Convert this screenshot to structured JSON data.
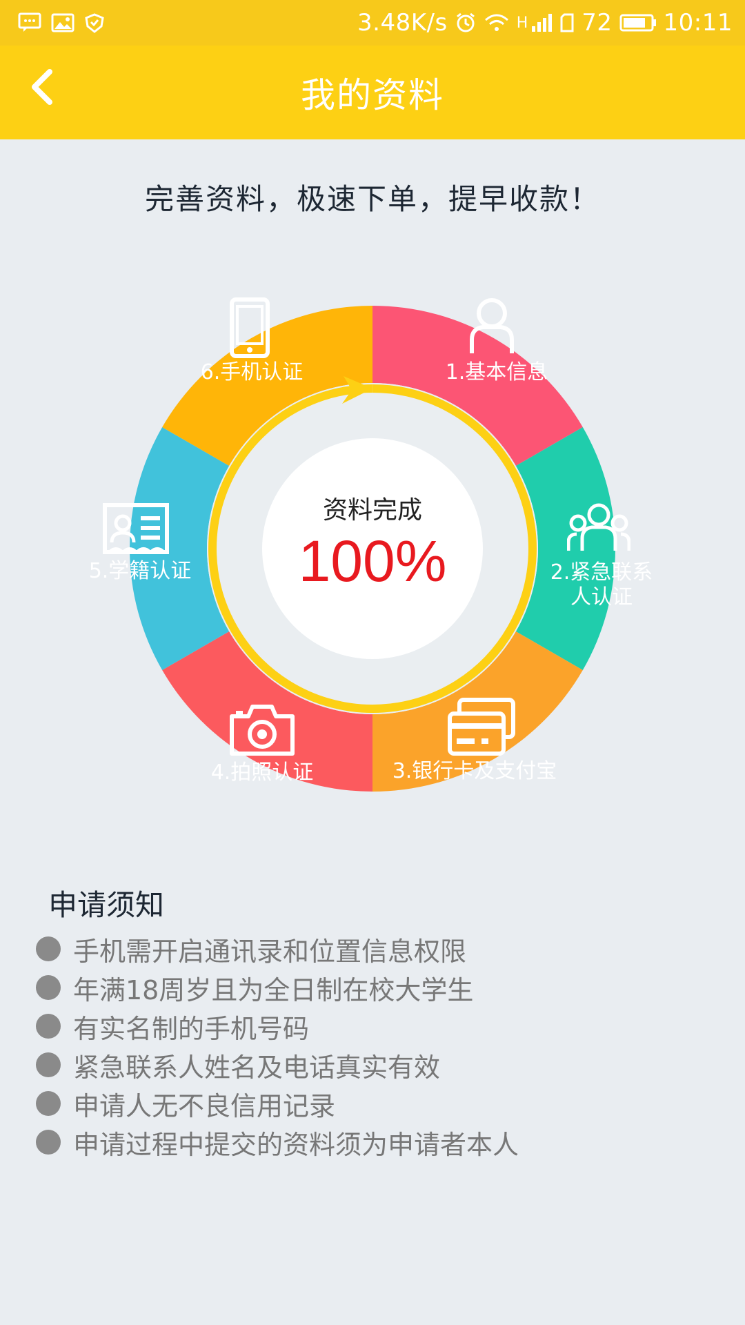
{
  "status_bar": {
    "net_speed": "3.48K/s",
    "network_type": "H",
    "battery": "72",
    "time": "10:11",
    "icons": [
      "message-icon",
      "image-icon",
      "shield-icon",
      "alarm-icon",
      "wifi-icon",
      "signal-icon",
      "sim-icon",
      "battery-icon"
    ]
  },
  "header": {
    "title": "我的资料",
    "back_icon": "chevron-left-icon"
  },
  "slogan": "完善资料，极速下单，提早收款！",
  "progress": {
    "label": "资料完成",
    "value": "100%",
    "fraction": 1.0
  },
  "segments": [
    {
      "label": "1.基本信息",
      "icon": "user-icon",
      "color": "#FC5574"
    },
    {
      "label_line1": "2.紧急联系",
      "label_line2": "人认证",
      "icon": "contacts-group-icon",
      "color": "#20CDAC"
    },
    {
      "label": "3.银行卡及支付宝",
      "icon": "cards-icon",
      "color": "#FBA32A"
    },
    {
      "label": "4.拍照认证",
      "icon": "camera-icon",
      "color": "#FC5A5E"
    },
    {
      "label": "5.学籍认证",
      "icon": "id-card-icon",
      "color": "#41C2DB"
    },
    {
      "label": "6.手机认证",
      "icon": "phone-icon",
      "color": "#FFB508"
    }
  ],
  "notice": {
    "title": "申请须知",
    "items": [
      "手机需开启通讯录和位置信息权限",
      "年满18周岁且为全日制在校大学生",
      "有实名制的手机号码",
      "紧急联系人姓名及电话真实有效",
      "申请人无不良信用记录",
      "申请过程中提交的资料须为申请者本人"
    ]
  },
  "colors": {
    "header_bg": "#FDD014",
    "status_bg": "#F7C91B",
    "progress_ring": "#FDD014",
    "percent": "#E8191F"
  }
}
